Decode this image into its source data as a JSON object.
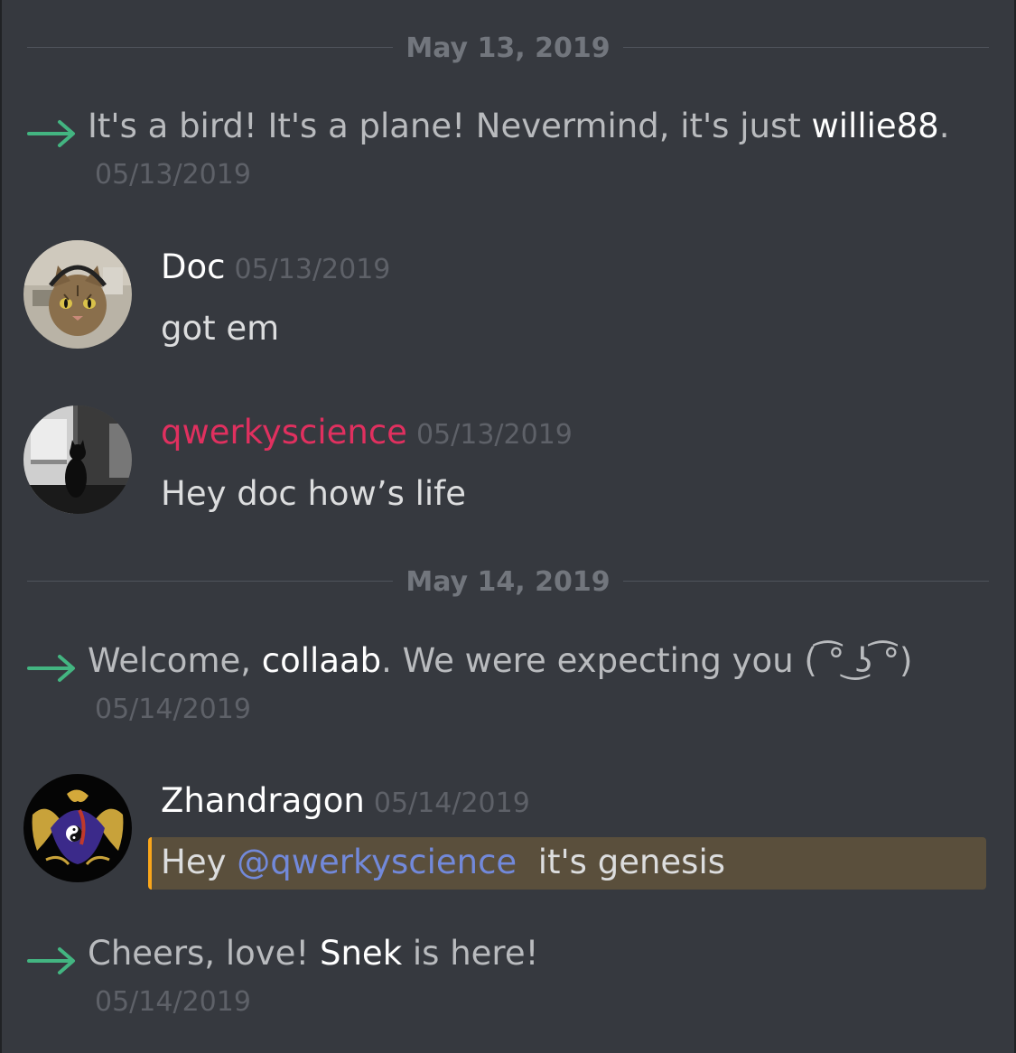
{
  "dividers": [
    {
      "label": "May 13, 2019"
    },
    {
      "label": "May 14, 2019"
    }
  ],
  "messages": [
    {
      "kind": "system",
      "prefix": "It's a bird! It's a plane! Nevermind, it's just ",
      "user": "willie88",
      "suffix": ".",
      "timestamp": "05/13/2019",
      "arrow_color": "#43b581"
    },
    {
      "kind": "user",
      "author": "Doc",
      "timestamp": "05/13/2019",
      "text": "got em",
      "avatar": "cat-headphones-avatar"
    },
    {
      "kind": "user",
      "author": "qwerkyscience",
      "author_color": "#e0305f",
      "timestamp": "05/13/2019",
      "text": "Hey doc how’s life",
      "avatar": "cat-silhouette-avatar"
    },
    {
      "kind": "system",
      "prefix": "Welcome, ",
      "user": "collaab",
      "suffix": ". We were expecting you ( ͡° ͜ʖ ͡°)",
      "timestamp": "05/14/2019",
      "arrow_color": "#43b581"
    },
    {
      "kind": "user",
      "author": "Zhandragon",
      "timestamp": "05/14/2019",
      "text_before": "Hey ",
      "mention": "@qwerkyscience",
      "text_after": "  it's genesis",
      "avatar": "dragon-avatar",
      "highlight_color": "#5a4f3c",
      "highlight_border": "#faa61a"
    },
    {
      "kind": "system",
      "prefix": "Cheers, love! ",
      "user": "Snek",
      "suffix": " is here!",
      "timestamp": "05/14/2019",
      "arrow_color": "#43b581"
    }
  ],
  "colors": {
    "background": "#36393f",
    "mention": "#7289da",
    "timestamp": "#5e6168"
  }
}
